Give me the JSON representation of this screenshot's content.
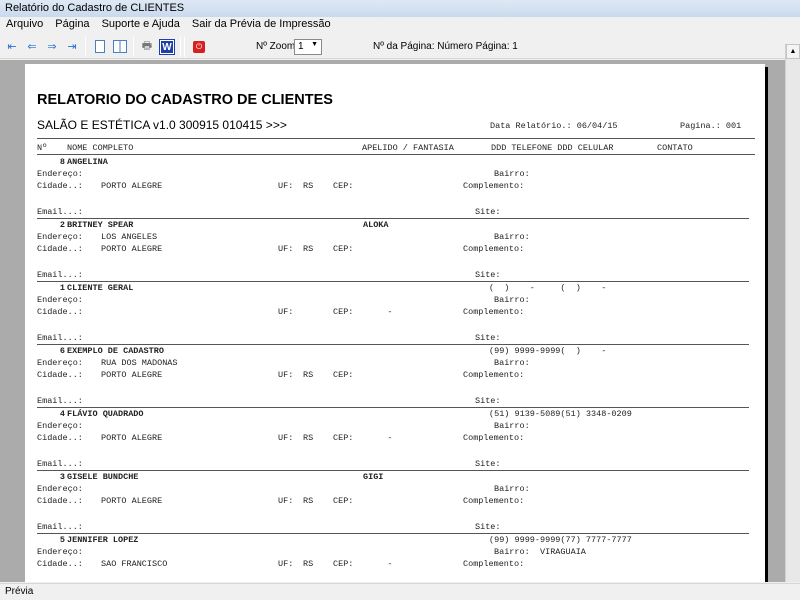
{
  "window": {
    "title": "Relatório do Cadastro de CLIENTES"
  },
  "menu": [
    "Arquivo",
    "Página",
    "Suporte e Ajuda",
    "Sair da Prévia de Impressão"
  ],
  "toolbar": {
    "zoom_label": "Nº Zoom",
    "zoom_value": "1",
    "page_label": "Nº da Página: Número Página: 1"
  },
  "report": {
    "title": "RELATORIO DO CADASTRO DE CLIENTES",
    "subtitle": "SALÃO E ESTÉTICA v1.0 300915 010415 >>>",
    "date": "Data Relatório.: 06/04/15",
    "page": "Pagina.: 001",
    "columns": {
      "num": "Nº",
      "name": "NOME COMPLETO",
      "apelido": "APELIDO / FANTASIA",
      "phones": "DDD TELEFONE DDD CELULAR",
      "contato": "CONTATO"
    },
    "labels": {
      "endereco": "Endereço:",
      "cidade": "Cidade..:",
      "uf": "UF:",
      "cep": "CEP:",
      "email": "Email...:",
      "bairro": "Bairro:",
      "complemento": "Complemento:",
      "site": "Site:"
    },
    "records": [
      {
        "num": "8",
        "name": "ANGELINA",
        "apelido": "",
        "phones": "",
        "endereco": "",
        "cidade": "PORTO ALEGRE",
        "uf": "RS",
        "cep": "",
        "bairro": ""
      },
      {
        "num": "2",
        "name": "BRITNEY SPEAR",
        "apelido": "ALOKA",
        "phones": "",
        "endereco": "LOS ANGELES",
        "cidade": "PORTO ALEGRE",
        "uf": "RS",
        "cep": "",
        "bairro": ""
      },
      {
        "num": "1",
        "name": "CLIENTE GERAL",
        "apelido": "",
        "phones": "(  )    -     (  )    -",
        "endereco": "",
        "cidade": "",
        "uf": "",
        "cep": "    -",
        "bairro": ""
      },
      {
        "num": "6",
        "name": "EXEMPLO DE CADASTRO",
        "apelido": "",
        "phones": "(99) 9999-9999(  )    -",
        "endereco": "RUA DOS MADONAS",
        "cidade": "PORTO ALEGRE",
        "uf": "RS",
        "cep": "",
        "bairro": ""
      },
      {
        "num": "4",
        "name": "FLÁVIO QUADRADO",
        "apelido": "",
        "phones": "(51) 9139-5089(51) 3348-0209",
        "endereco": "",
        "cidade": "PORTO ALEGRE",
        "uf": "RS",
        "cep": "    -",
        "bairro": ""
      },
      {
        "num": "3",
        "name": "GISELE BUNDCHE",
        "apelido": "GIGI",
        "phones": "",
        "endereco": "",
        "cidade": "PORTO ALEGRE",
        "uf": "RS",
        "cep": "",
        "bairro": ""
      },
      {
        "num": "5",
        "name": "JENNIFER LOPEZ",
        "apelido": "",
        "phones": "(99) 9999-9999(77) 7777-7777",
        "endereco": "",
        "cidade": "SAO FRANCISCO",
        "uf": "RS",
        "cep": "    -",
        "bairro": "VIRAGUAIA"
      }
    ]
  },
  "status": {
    "text": "Prévia"
  }
}
